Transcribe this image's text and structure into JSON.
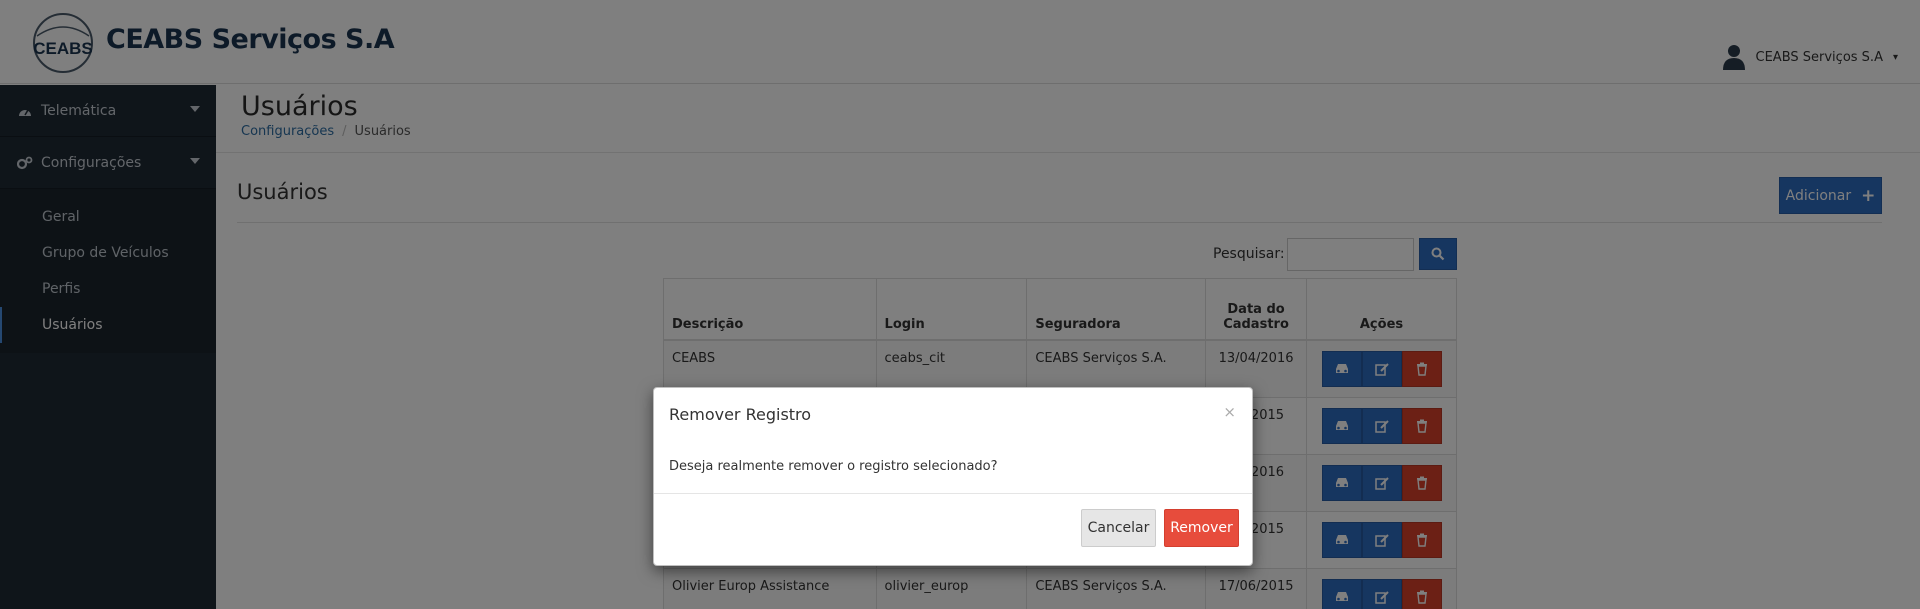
{
  "app": {
    "brand": "CEABS Serviços S.A",
    "logo_text": "CEABS",
    "user_name": "CEABS Serviços S.A"
  },
  "sidebar": {
    "items": [
      {
        "label": "Telemática",
        "icon": "dashboard-icon"
      },
      {
        "label": "Configurações",
        "icon": "gears-icon"
      }
    ],
    "submenu": [
      "Geral",
      "Grupo de Veículos",
      "Perfis",
      "Usuários"
    ],
    "active": "Usuários"
  },
  "page": {
    "title": "Usuários",
    "breadcrumb": [
      "Configurações",
      "Usuários"
    ]
  },
  "panel": {
    "title": "Usuários",
    "add_label": "Adicionar",
    "search_label": "Pesquisar:",
    "search_value": ""
  },
  "table": {
    "headers": [
      "Descrição",
      "Login",
      "Seguradora",
      "Data do Cadastro",
      "Ações"
    ],
    "rows": [
      {
        "descricao": "CEABS",
        "login": "ceabs_cit",
        "seguradora": "CEABS Serviços S.A.",
        "data": "13/04/2016"
      },
      {
        "descricao": "",
        "login": "",
        "seguradora": "",
        "data": "/2015"
      },
      {
        "descricao": "",
        "login": "",
        "seguradora": "",
        "data": "/2016"
      },
      {
        "descricao": "",
        "login": "",
        "seguradora": "",
        "data": "/2015"
      },
      {
        "descricao": "Olivier Europ Assistance",
        "login": "olivier_europ",
        "seguradora": "CEABS Serviços S.A.",
        "data": "17/06/2015"
      }
    ]
  },
  "modal": {
    "title": "Remover Registro",
    "close": "×",
    "body": "Deseja realmente remover o registro selecionado?",
    "cancel_label": "Cancelar",
    "remove_label": "Remover"
  },
  "colors": {
    "primary": "#2d6cc0",
    "danger": "#d9412b",
    "remove_button": "#e74c3c",
    "sidebar_bg": "#1f2a35",
    "brand_text": "#1a3550"
  }
}
